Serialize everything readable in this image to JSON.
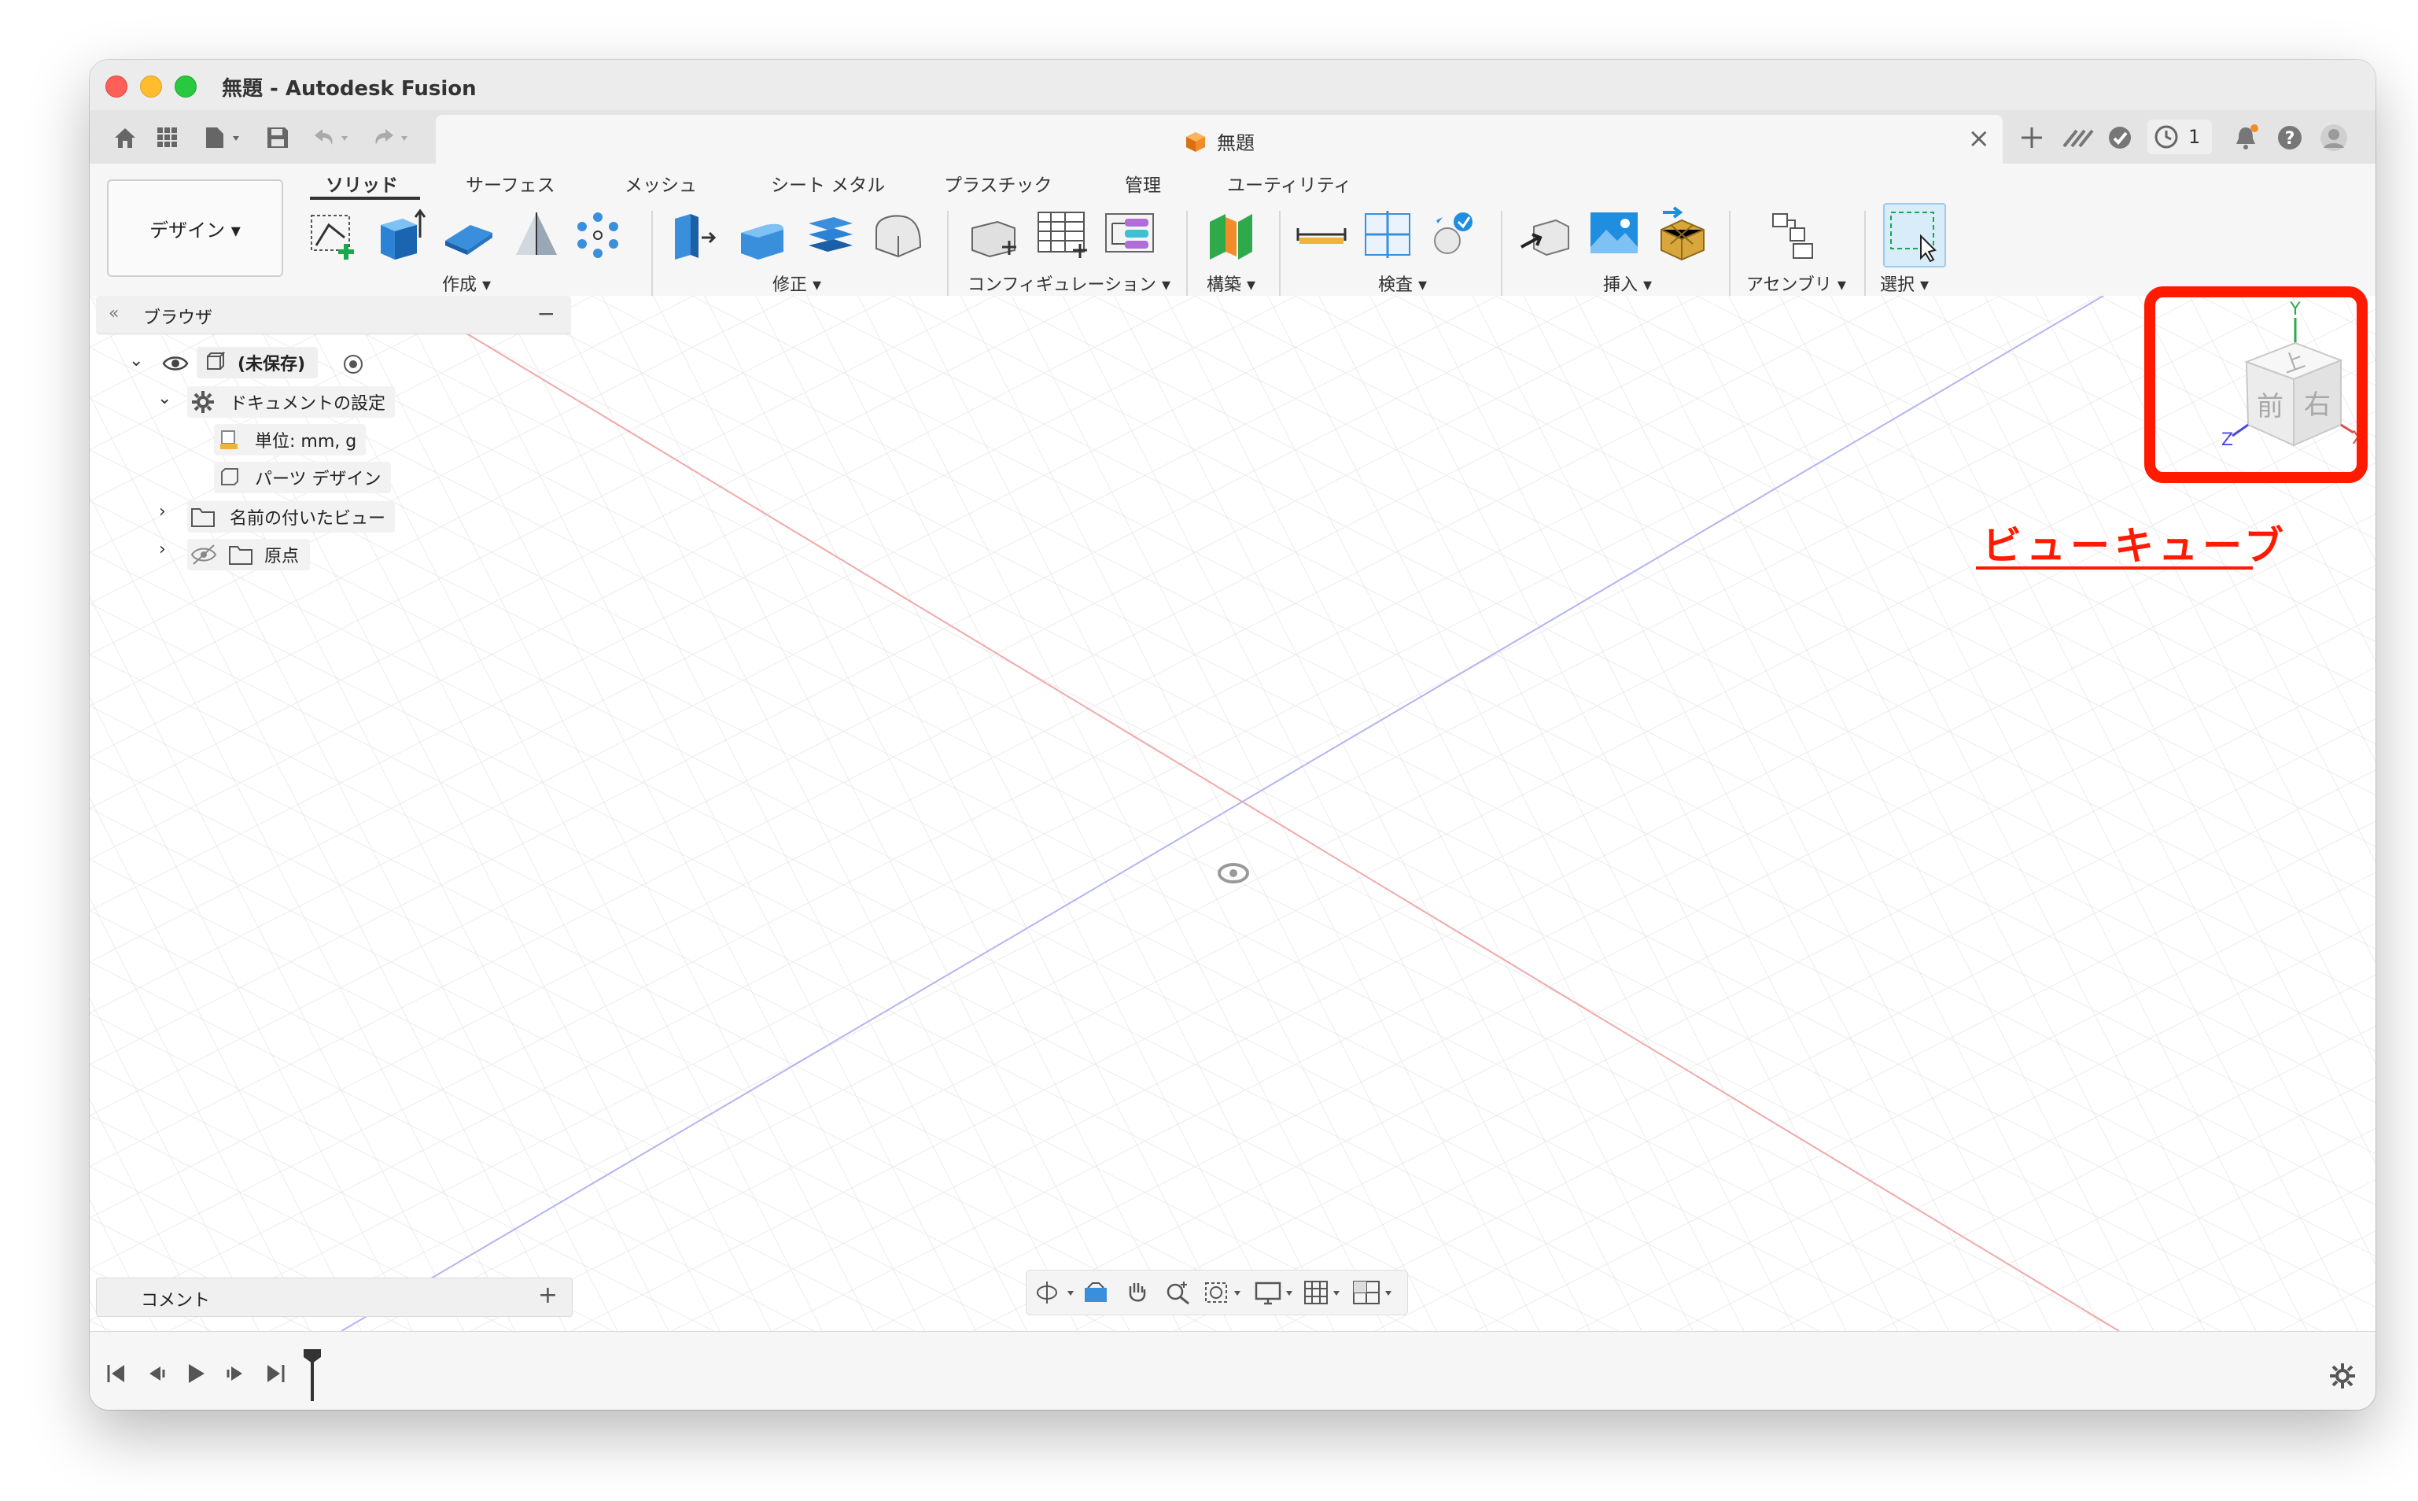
{
  "window": {
    "title": "無題 - Autodesk Fusion"
  },
  "tab": {
    "title": "無題"
  },
  "topbar": {
    "job_count": "1"
  },
  "ribbon": {
    "workspace": "デザイン ▾",
    "tabs": [
      "ソリッド",
      "サーフェス",
      "メッシュ",
      "シート メタル",
      "プラスチック",
      "管理",
      "ユーティリティ"
    ],
    "groups": {
      "create": "作成 ▾",
      "modify": "修正 ▾",
      "configure": "コンフィギュレーション ▾",
      "construct": "構築 ▾",
      "inspect": "検査 ▾",
      "insert": "挿入 ▾",
      "assemble": "アセンブリ ▾",
      "select": "選択 ▾"
    }
  },
  "browser": {
    "title": "ブラウザ",
    "root": "(未保存)",
    "doc_settings": "ドキュメントの設定",
    "units": "単位: mm, g",
    "design_type": "パーツ デザイン",
    "named_views": "名前の付いたビュー",
    "origin": "原点"
  },
  "comments": {
    "label": "コメント"
  },
  "viewcube": {
    "top": "上",
    "front": "前",
    "right": "右",
    "axis_x": "X",
    "axis_y": "Y",
    "axis_z": "Z"
  },
  "annotation": {
    "label": "ビューキューブ"
  },
  "colors": {
    "accent_blue": "#1f8de0",
    "annotation_red": "#ff1a00",
    "axis_red": "#f0a0a0",
    "axis_blue": "#a8a8f0"
  }
}
